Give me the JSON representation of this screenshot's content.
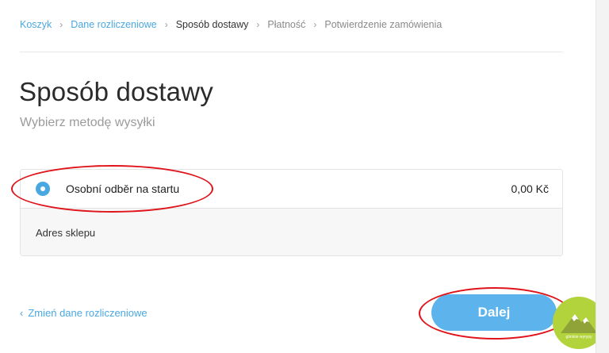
{
  "breadcrumb": {
    "items": [
      {
        "label": "Koszyk",
        "state": "link"
      },
      {
        "label": "Dane rozliczeniowe",
        "state": "link"
      },
      {
        "label": "Sposób dostawy",
        "state": "current"
      },
      {
        "label": "Płatność",
        "state": "future"
      },
      {
        "label": "Potwierdzenie zamówienia",
        "state": "future"
      }
    ],
    "separator": "›"
  },
  "header": {
    "title": "Sposób dostawy",
    "subtitle": "Wybierz metodę wysyłki"
  },
  "shipping": {
    "option_label": "Osobní odběr na startu",
    "option_price": "0,00 Kč",
    "selected": true,
    "address_label": "Adres sklepu"
  },
  "footer": {
    "back_chevron": "‹",
    "back_label": "Zmień dane rozliczeniowe",
    "next_label": "Dalej"
  },
  "badge": {
    "text": "górskie wyrypy",
    "icon": "mountain-icon"
  },
  "colors": {
    "accent": "#4aa8e0",
    "button": "#5db4ec",
    "annotation": "#e0141b",
    "badge": "#b2d33b"
  }
}
